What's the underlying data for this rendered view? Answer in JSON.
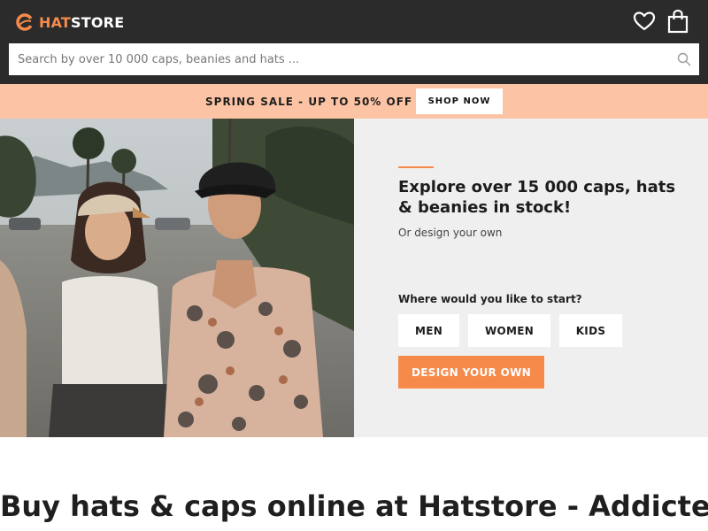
{
  "header": {
    "logo": {
      "hat": "HAT",
      "store": "STORE"
    },
    "search": {
      "placeholder": "Search by over 10 000 caps, beanies and hats ..."
    },
    "icons": [
      "heart-icon",
      "shopping-bag-icon",
      "search-icon"
    ]
  },
  "promo": {
    "text": "SPRING SALE - UP TO 50% OFF",
    "button": "SHOP NOW"
  },
  "hero": {
    "title": "Explore over 15 000 caps, hats & beanies in stock!",
    "subtitle": "Or design your own",
    "question": "Where would you like to start?",
    "categories": [
      "MEN",
      "WOMEN",
      "KIDS"
    ],
    "design_button": "DESIGN YOUR OWN"
  },
  "main": {
    "heading": "Buy hats & caps online at Hatstore - Addicted"
  },
  "colors": {
    "header_bg": "#2b2b2b",
    "accent": "#f58a4b",
    "promo_bg": "#fcc4a5",
    "hero_panel_bg": "#efefef"
  }
}
